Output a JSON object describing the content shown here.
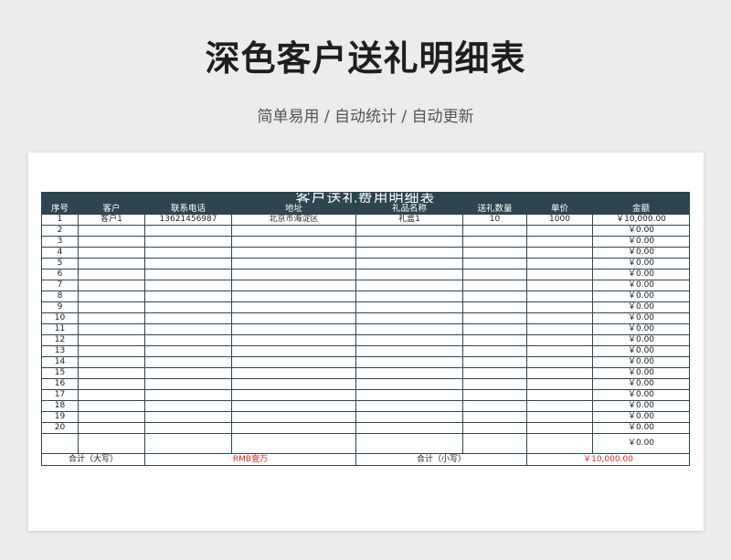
{
  "page": {
    "title": "深色客户送礼明细表",
    "subtitle": "简单易用 / 自动统计 / 自动更新"
  },
  "table": {
    "title": "客户送礼费用明细表",
    "columns": [
      "序号",
      "客户",
      "联系电话",
      "地址",
      "礼品名称",
      "送礼数量",
      "单价",
      "金额"
    ],
    "rows": [
      {
        "no": "1",
        "customer": "客户1",
        "phone": "13621456987",
        "address": "北京市海淀区",
        "gift": "礼盒1",
        "qty": "10",
        "price": "1000",
        "amount": "￥10,000.00"
      },
      {
        "no": "2",
        "customer": "",
        "phone": "",
        "address": "",
        "gift": "",
        "qty": "",
        "price": "",
        "amount": "￥0.00"
      },
      {
        "no": "3",
        "customer": "",
        "phone": "",
        "address": "",
        "gift": "",
        "qty": "",
        "price": "",
        "amount": "￥0.00"
      },
      {
        "no": "4",
        "customer": "",
        "phone": "",
        "address": "",
        "gift": "",
        "qty": "",
        "price": "",
        "amount": "￥0.00"
      },
      {
        "no": "5",
        "customer": "",
        "phone": "",
        "address": "",
        "gift": "",
        "qty": "",
        "price": "",
        "amount": "￥0.00"
      },
      {
        "no": "6",
        "customer": "",
        "phone": "",
        "address": "",
        "gift": "",
        "qty": "",
        "price": "",
        "amount": "￥0.00"
      },
      {
        "no": "7",
        "customer": "",
        "phone": "",
        "address": "",
        "gift": "",
        "qty": "",
        "price": "",
        "amount": "￥0.00"
      },
      {
        "no": "8",
        "customer": "",
        "phone": "",
        "address": "",
        "gift": "",
        "qty": "",
        "price": "",
        "amount": "￥0.00"
      },
      {
        "no": "9",
        "customer": "",
        "phone": "",
        "address": "",
        "gift": "",
        "qty": "",
        "price": "",
        "amount": "￥0.00"
      },
      {
        "no": "10",
        "customer": "",
        "phone": "",
        "address": "",
        "gift": "",
        "qty": "",
        "price": "",
        "amount": "￥0.00"
      },
      {
        "no": "11",
        "customer": "",
        "phone": "",
        "address": "",
        "gift": "",
        "qty": "",
        "price": "",
        "amount": "￥0.00"
      },
      {
        "no": "12",
        "customer": "",
        "phone": "",
        "address": "",
        "gift": "",
        "qty": "",
        "price": "",
        "amount": "￥0.00"
      },
      {
        "no": "13",
        "customer": "",
        "phone": "",
        "address": "",
        "gift": "",
        "qty": "",
        "price": "",
        "amount": "￥0.00"
      },
      {
        "no": "14",
        "customer": "",
        "phone": "",
        "address": "",
        "gift": "",
        "qty": "",
        "price": "",
        "amount": "￥0.00"
      },
      {
        "no": "15",
        "customer": "",
        "phone": "",
        "address": "",
        "gift": "",
        "qty": "",
        "price": "",
        "amount": "￥0.00"
      },
      {
        "no": "16",
        "customer": "",
        "phone": "",
        "address": "",
        "gift": "",
        "qty": "",
        "price": "",
        "amount": "￥0.00"
      },
      {
        "no": "17",
        "customer": "",
        "phone": "",
        "address": "",
        "gift": "",
        "qty": "",
        "price": "",
        "amount": "￥0.00"
      },
      {
        "no": "18",
        "customer": "",
        "phone": "",
        "address": "",
        "gift": "",
        "qty": "",
        "price": "",
        "amount": "￥0.00"
      },
      {
        "no": "19",
        "customer": "",
        "phone": "",
        "address": "",
        "gift": "",
        "qty": "",
        "price": "",
        "amount": "￥0.00"
      },
      {
        "no": "20",
        "customer": "",
        "phone": "",
        "address": "",
        "gift": "",
        "qty": "",
        "price": "",
        "amount": "￥0.00"
      },
      {
        "no": "",
        "customer": "",
        "phone": "",
        "address": "",
        "gift": "",
        "qty": "",
        "price": "",
        "amount": "￥0.00"
      }
    ],
    "total": {
      "label_upper": "合计（大写）",
      "value_upper": "RMB壹万",
      "label_lower": "合计（小写）",
      "value_lower": "￥10,000.00"
    },
    "colors": {
      "header_bg": "#2c4550",
      "total_text": "#d62a2a"
    }
  }
}
